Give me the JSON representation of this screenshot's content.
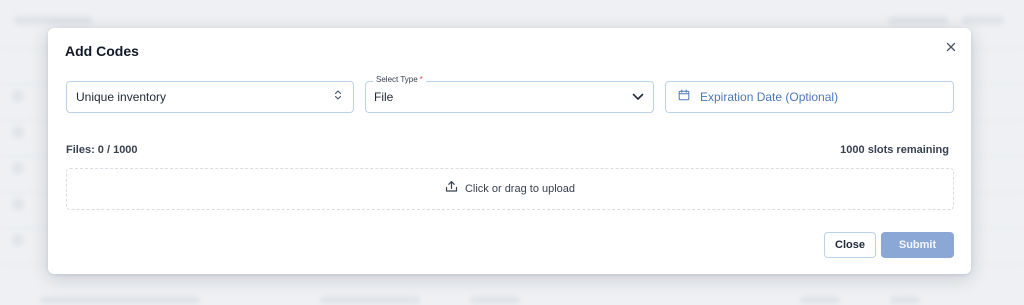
{
  "modal": {
    "title": "Add Codes",
    "inventory_select": {
      "value": "Unique inventory"
    },
    "type_select": {
      "label": "Select Type",
      "required_mark": "*",
      "value": "File"
    },
    "expiration_field": {
      "placeholder": "Expiration Date (Optional)"
    },
    "files_count": "Files: 0 / 1000",
    "slots_remaining": "1000 slots remaining",
    "dropzone_text": "Click or drag to upload",
    "buttons": {
      "close": "Close",
      "submit": "Submit"
    }
  },
  "colors": {
    "border": "#b9d2ec",
    "submit_bg": "#8ba7d6",
    "date_text": "#4a78b8",
    "required": "#d94848"
  },
  "icons": [
    "close-icon",
    "unfold-icon",
    "chevron-down-icon",
    "calendar-icon",
    "upload-icon"
  ]
}
